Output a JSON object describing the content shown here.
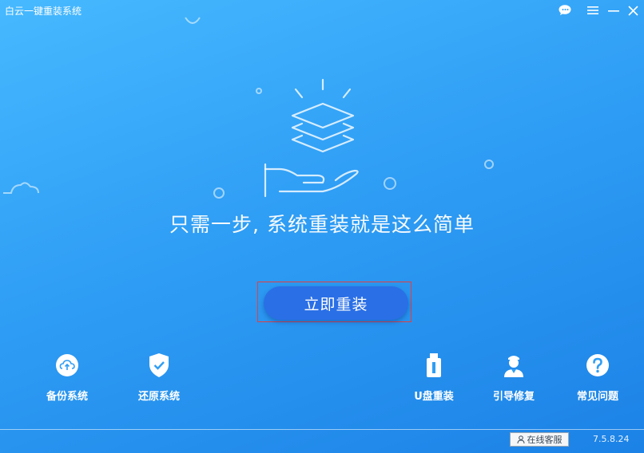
{
  "window": {
    "title": "白云一键重装系统",
    "controls": {
      "chat_icon": "wechat-icon",
      "menu_icon": "menu-icon",
      "minimize_icon": "minimize-icon",
      "close_icon": "close-icon"
    }
  },
  "hero": {
    "illustration": "layers-on-hand-icon",
    "slogan": "只需一步, 系统重装就是这么简单"
  },
  "main_action": {
    "label": "立即重装"
  },
  "tools_left": [
    {
      "label": "备份系统",
      "icon": "cloud-upload-icon"
    },
    {
      "label": "还原系统",
      "icon": "shield-check-icon"
    }
  ],
  "tools_right": [
    {
      "label": "U盘重装",
      "icon": "usb-drive-icon"
    },
    {
      "label": "引导修复",
      "icon": "technician-icon"
    },
    {
      "label": "常见问题",
      "icon": "question-icon"
    }
  ],
  "footer": {
    "contact_label": "在线客服",
    "version": "7.5.8.24"
  },
  "colors": {
    "bg_top": "#46b9ff",
    "bg_bottom": "#1c82e6",
    "button": "#2a6fe6",
    "highlight_border": "#e04040"
  }
}
